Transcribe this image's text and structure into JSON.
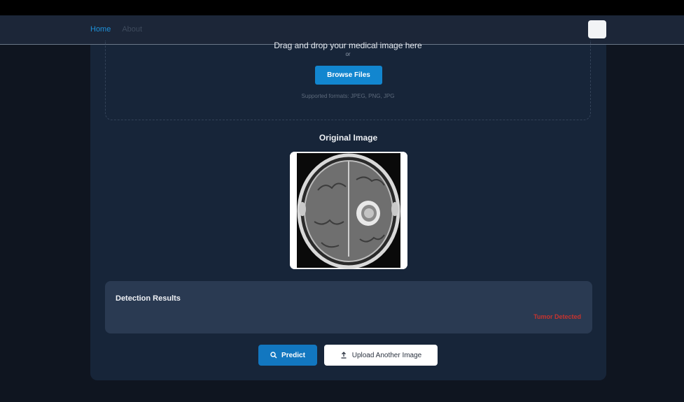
{
  "nav": {
    "items": [
      {
        "label": "Home",
        "active": true
      },
      {
        "label": "About",
        "active": false
      }
    ]
  },
  "upload": {
    "title": "Drag and drop your medical image here",
    "or_text": "or",
    "browse_label": "Browse Files",
    "formats": "Supported formats: JPEG, PNG, JPG"
  },
  "original": {
    "title": "Original Image",
    "image_icon": "brain-mri-image"
  },
  "results": {
    "title": "Detection Results",
    "status": "Tumor Detected",
    "status_color": "#c8332e"
  },
  "actions": {
    "predict_label": "Predict",
    "predict_icon": "search-icon",
    "upload_label": "Upload Another Image",
    "upload_icon": "upload-icon"
  },
  "colors": {
    "accent": "#1286cf",
    "background": "#0f1520",
    "card": "#172539"
  }
}
